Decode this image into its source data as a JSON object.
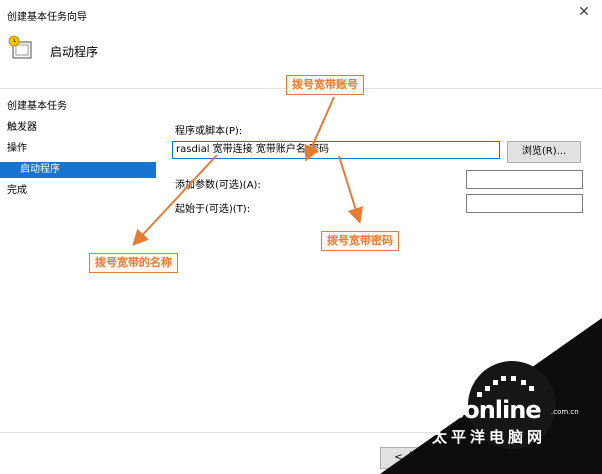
{
  "window": {
    "title": "创建基本任务向导",
    "close_glyph": "✕"
  },
  "header": {
    "heading": "启动程序",
    "icon": "wizard-clock-icon"
  },
  "sidebar": {
    "items": [
      {
        "label": "创建基本任务",
        "selected": false
      },
      {
        "label": "触发器",
        "selected": false
      },
      {
        "label": "操作",
        "selected": false
      },
      {
        "label": "启动程序",
        "selected": true
      },
      {
        "label": "完成",
        "selected": false
      }
    ]
  },
  "form": {
    "program_label": "程序或脚本(P):",
    "program_value": "rasdial 宽带连接 宽带账户名 密码",
    "browse_label": "浏览(R)...",
    "args_label": "添加参数(可选)(A):",
    "args_value": "",
    "start_label": "起始于(可选)(T):",
    "start_value": ""
  },
  "footer": {
    "back_label": "< 上一步"
  },
  "annotations": {
    "account": "拨号宽带账号",
    "password": "拨号宽带密码",
    "name": "拨号宽带的名称",
    "color": "#e37d33"
  },
  "watermark": {
    "brand": "PConline",
    "domain": ".com.cn",
    "cn": "太平洋电脑网"
  }
}
